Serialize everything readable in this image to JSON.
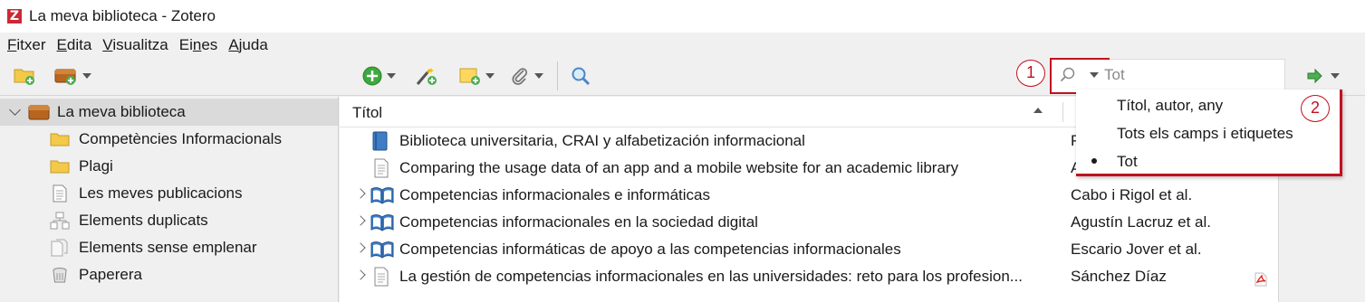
{
  "window": {
    "title": "La meva biblioteca - Zotero",
    "logo_letter": "Z"
  },
  "menu": [
    {
      "label_u": "F",
      "label_rest": "itxer"
    },
    {
      "label_u": "E",
      "label_rest": "dita"
    },
    {
      "label_u": "V",
      "label_rest": "isualitza"
    },
    {
      "label_pre": "Ei",
      "label_u": "n",
      "label_rest": "es"
    },
    {
      "label_u": "A",
      "label_rest": "juda"
    }
  ],
  "toolbar": {
    "icons": [
      "new-collection-icon",
      "new-library-icon",
      "new-item-icon",
      "magic-wand-icon",
      "new-note-icon",
      "attachment-icon",
      "advanced-search-icon",
      "sync-arrow-icon"
    ]
  },
  "search": {
    "value": "Tot",
    "mode_options": [
      "Títol, autor, any",
      "Tots els camps i etiquetes",
      "Tot"
    ],
    "selected_mode": "Tot"
  },
  "callouts": {
    "one": "1",
    "two": "2"
  },
  "collections": {
    "library": "La meva biblioteca",
    "items": [
      {
        "label": "Competències Informacionals",
        "icon": "folder-icon"
      },
      {
        "label": "Plagi",
        "icon": "folder-icon"
      },
      {
        "label": "Les meves publicacions",
        "icon": "document-icon"
      },
      {
        "label": "Elements duplicats",
        "icon": "duplicate-icon"
      },
      {
        "label": "Elements sense emplenar",
        "icon": "unfiled-icon"
      },
      {
        "label": "Paperera",
        "icon": "trash-icon"
      }
    ]
  },
  "items_table": {
    "columns": {
      "title": "Títol"
    },
    "rows": [
      {
        "title": "Biblioteca universitaria, CRAI y alfabetización informacional",
        "creator": "P",
        "icon": "book-icon",
        "expandable": false
      },
      {
        "title": "Comparing the usage data of an app and a mobile website for an academic library",
        "creator": "A",
        "icon": "document-icon",
        "expandable": false
      },
      {
        "title": "Competencias informacionales e informáticas",
        "creator": "Cabo i Rigol et al.",
        "icon": "book-section-icon",
        "expandable": true
      },
      {
        "title": "Competencias informacionales en la sociedad digital",
        "creator": "Agustín Lacruz et al.",
        "icon": "book-section-icon",
        "expandable": true
      },
      {
        "title": "Competencias informáticas de apoyo a las competencias informacionales",
        "creator": "Escario Jover et al.",
        "icon": "book-section-icon",
        "expandable": true
      },
      {
        "title": "La gestión de competencias informacionales en las universidades: reto para los profesion...",
        "creator": "Sánchez Díaz",
        "icon": "document-icon",
        "expandable": true,
        "attachment": "pdf-icon"
      }
    ]
  },
  "colors": {
    "accent_red": "#c0111f",
    "zotero_red": "#cc2936",
    "folder_yellow": "#f3c94a"
  }
}
